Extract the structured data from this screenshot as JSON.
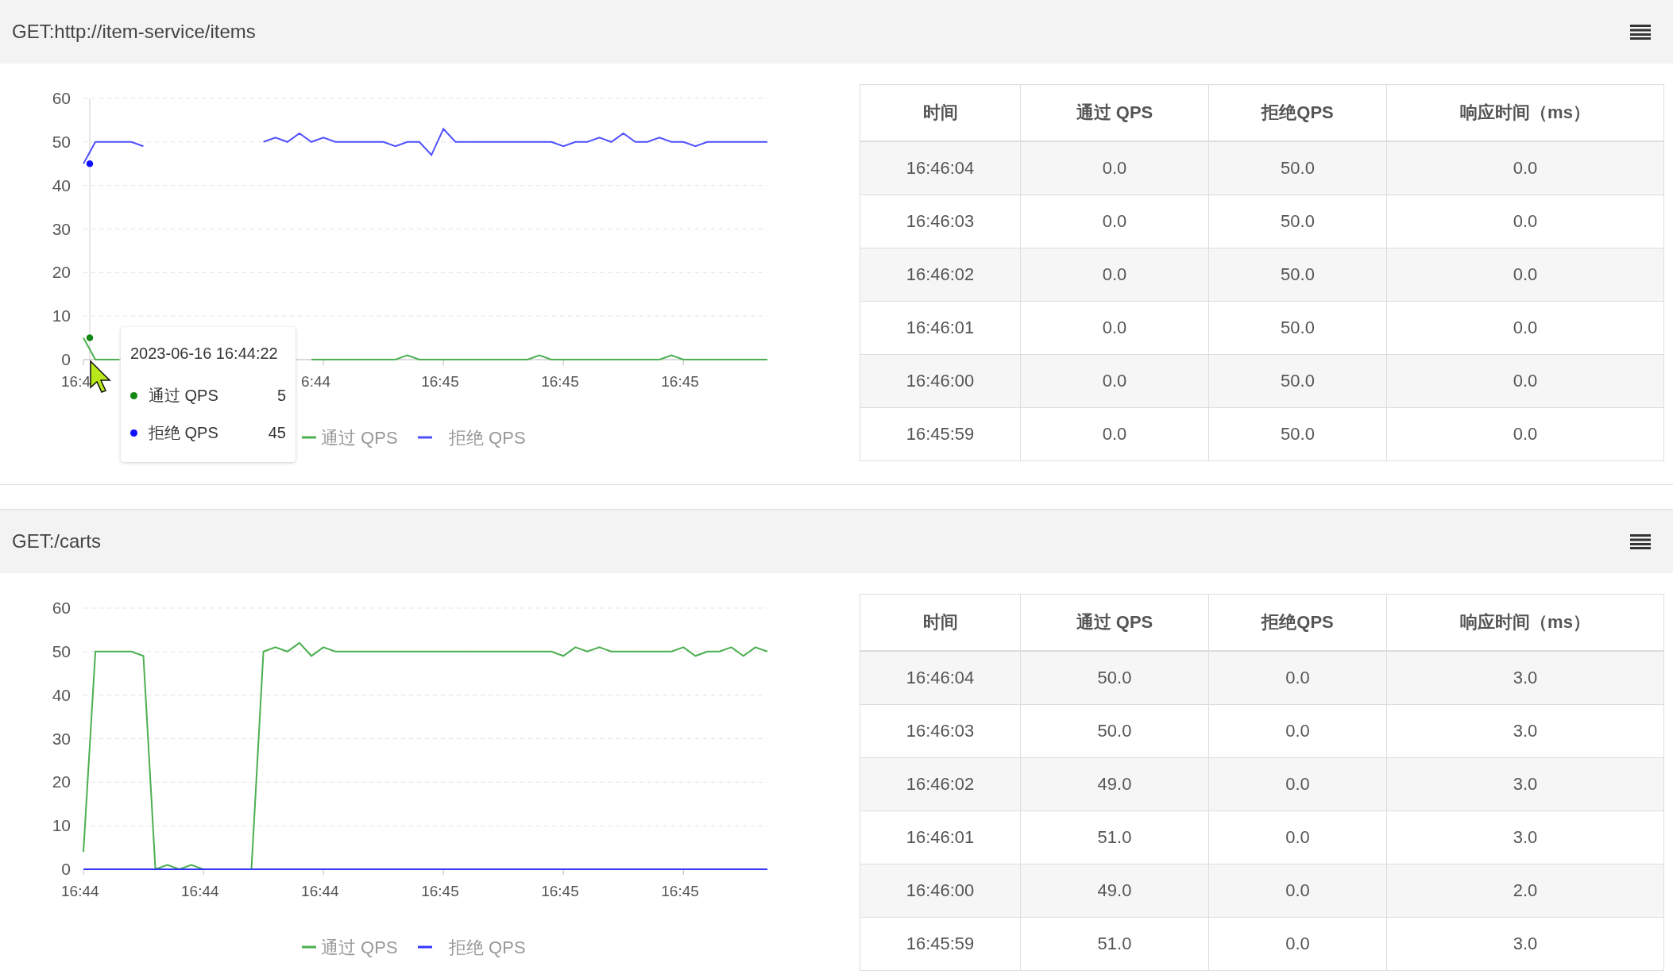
{
  "panels": [
    {
      "title": "GET:http://item-service/items",
      "chart_data": {
        "type": "line",
        "categories": [
          "16:4",
          null,
          null,
          null,
          null,
          null,
          null,
          null,
          null,
          null,
          null,
          null,
          null,
          null,
          null,
          null,
          null,
          null,
          null,
          null,
          "6:44",
          null,
          null,
          null,
          null,
          null,
          null,
          null,
          null,
          null,
          "16:45",
          null,
          null,
          null,
          null,
          null,
          null,
          null,
          null,
          null,
          "16:45",
          null,
          null,
          null,
          null,
          null,
          null,
          null,
          null,
          null,
          "16:45",
          null,
          null,
          null,
          null,
          null,
          null,
          null
        ],
        "ylim": [
          0,
          60
        ],
        "yticks": [
          0,
          10,
          20,
          30,
          40,
          50,
          60
        ],
        "grid": true,
        "legend": true,
        "series": [
          {
            "name": "通过 QPS",
            "color": "#4caf50",
            "values": [
              5,
              0,
              0,
              0,
              null,
              null,
              null,
              null,
              null,
              null,
              null,
              null,
              null,
              null,
              null,
              null,
              null,
              null,
              null,
              0,
              0,
              0,
              0,
              0,
              0,
              0,
              0,
              1,
              0,
              0,
              0,
              0,
              0,
              0,
              0,
              0,
              0,
              0,
              1,
              0,
              0,
              0,
              0,
              0,
              0,
              0,
              0,
              0,
              0,
              1,
              0,
              0,
              0,
              0,
              0,
              0,
              0,
              0
            ]
          },
          {
            "name": "拒绝 QPS",
            "color": "#5050ff",
            "values": [
              45,
              50,
              50,
              50,
              50,
              49,
              null,
              null,
              null,
              null,
              null,
              null,
              null,
              null,
              null,
              50,
              51,
              50,
              52,
              50,
              51,
              50,
              50,
              50,
              50,
              50,
              49,
              50,
              50,
              47,
              53,
              50,
              50,
              50,
              50,
              50,
              50,
              50,
              50,
              50,
              49,
              50,
              50,
              51,
              50,
              52,
              50,
              50,
              51,
              50,
              50,
              49,
              50,
              50,
              50,
              50,
              50,
              50
            ]
          }
        ]
      },
      "tooltip": {
        "title": "2023-06-16 16:44:22",
        "rows": [
          {
            "label": "通过 QPS",
            "value": "5",
            "color": "#118811"
          },
          {
            "label": "拒绝 QPS",
            "value": "45",
            "color": "#1010ff"
          }
        ]
      },
      "table": {
        "columns": [
          "时间",
          "通过 QPS",
          "拒绝QPS",
          "响应时间（ms）"
        ],
        "rows": [
          [
            "16:46:04",
            "0.0",
            "50.0",
            "0.0"
          ],
          [
            "16:46:03",
            "0.0",
            "50.0",
            "0.0"
          ],
          [
            "16:46:02",
            "0.0",
            "50.0",
            "0.0"
          ],
          [
            "16:46:01",
            "0.0",
            "50.0",
            "0.0"
          ],
          [
            "16:46:00",
            "0.0",
            "50.0",
            "0.0"
          ],
          [
            "16:45:59",
            "0.0",
            "50.0",
            "0.0"
          ]
        ]
      }
    },
    {
      "title": "GET:/carts",
      "chart_data": {
        "type": "line",
        "categories": [
          "16:44",
          null,
          null,
          null,
          null,
          null,
          null,
          null,
          null,
          null,
          "16:44",
          null,
          null,
          null,
          null,
          null,
          null,
          null,
          null,
          null,
          "16:44",
          null,
          null,
          null,
          null,
          null,
          null,
          null,
          null,
          null,
          "16:45",
          null,
          null,
          null,
          null,
          null,
          null,
          null,
          null,
          null,
          "16:45",
          null,
          null,
          null,
          null,
          null,
          null,
          null,
          null,
          null,
          "16:45",
          null,
          null,
          null,
          null,
          null,
          null,
          null
        ],
        "ylim": [
          0,
          60
        ],
        "yticks": [
          0,
          10,
          20,
          30,
          40,
          50,
          60
        ],
        "grid": true,
        "legend": true,
        "series": [
          {
            "name": "通过 QPS",
            "color": "#4caf50",
            "values": [
              4,
              50,
              50,
              50,
              50,
              49,
              0,
              1,
              0,
              1,
              0,
              0,
              0,
              0,
              0,
              50,
              51,
              50,
              52,
              49,
              51,
              50,
              50,
              50,
              50,
              50,
              50,
              50,
              50,
              50,
              50,
              50,
              50,
              50,
              50,
              50,
              50,
              50,
              50,
              50,
              49,
              51,
              50,
              51,
              50,
              50,
              50,
              50,
              50,
              50,
              51,
              49,
              50,
              50,
              51,
              49,
              51,
              50
            ]
          },
          {
            "name": "拒绝 QPS",
            "color": "#3535ff",
            "values": [
              0,
              0,
              0,
              0,
              0,
              0,
              0,
              0,
              0,
              0,
              0,
              0,
              0,
              0,
              0,
              0,
              0,
              0,
              0,
              0,
              0,
              0,
              0,
              0,
              0,
              0,
              0,
              0,
              0,
              0,
              0,
              0,
              0,
              0,
              0,
              0,
              0,
              0,
              0,
              0,
              0,
              0,
              0,
              0,
              0,
              0,
              0,
              0,
              0,
              0,
              0,
              0,
              0,
              0,
              0,
              0,
              0,
              0
            ]
          }
        ]
      },
      "table": {
        "columns": [
          "时间",
          "通过 QPS",
          "拒绝QPS",
          "响应时间（ms）"
        ],
        "rows": [
          [
            "16:46:04",
            "50.0",
            "0.0",
            "3.0"
          ],
          [
            "16:46:03",
            "50.0",
            "0.0",
            "3.0"
          ],
          [
            "16:46:02",
            "49.0",
            "0.0",
            "3.0"
          ],
          [
            "16:46:01",
            "51.0",
            "0.0",
            "3.0"
          ],
          [
            "16:46:00",
            "49.0",
            "0.0",
            "2.0"
          ],
          [
            "16:45:59",
            "51.0",
            "0.0",
            "3.0"
          ]
        ]
      }
    }
  ]
}
